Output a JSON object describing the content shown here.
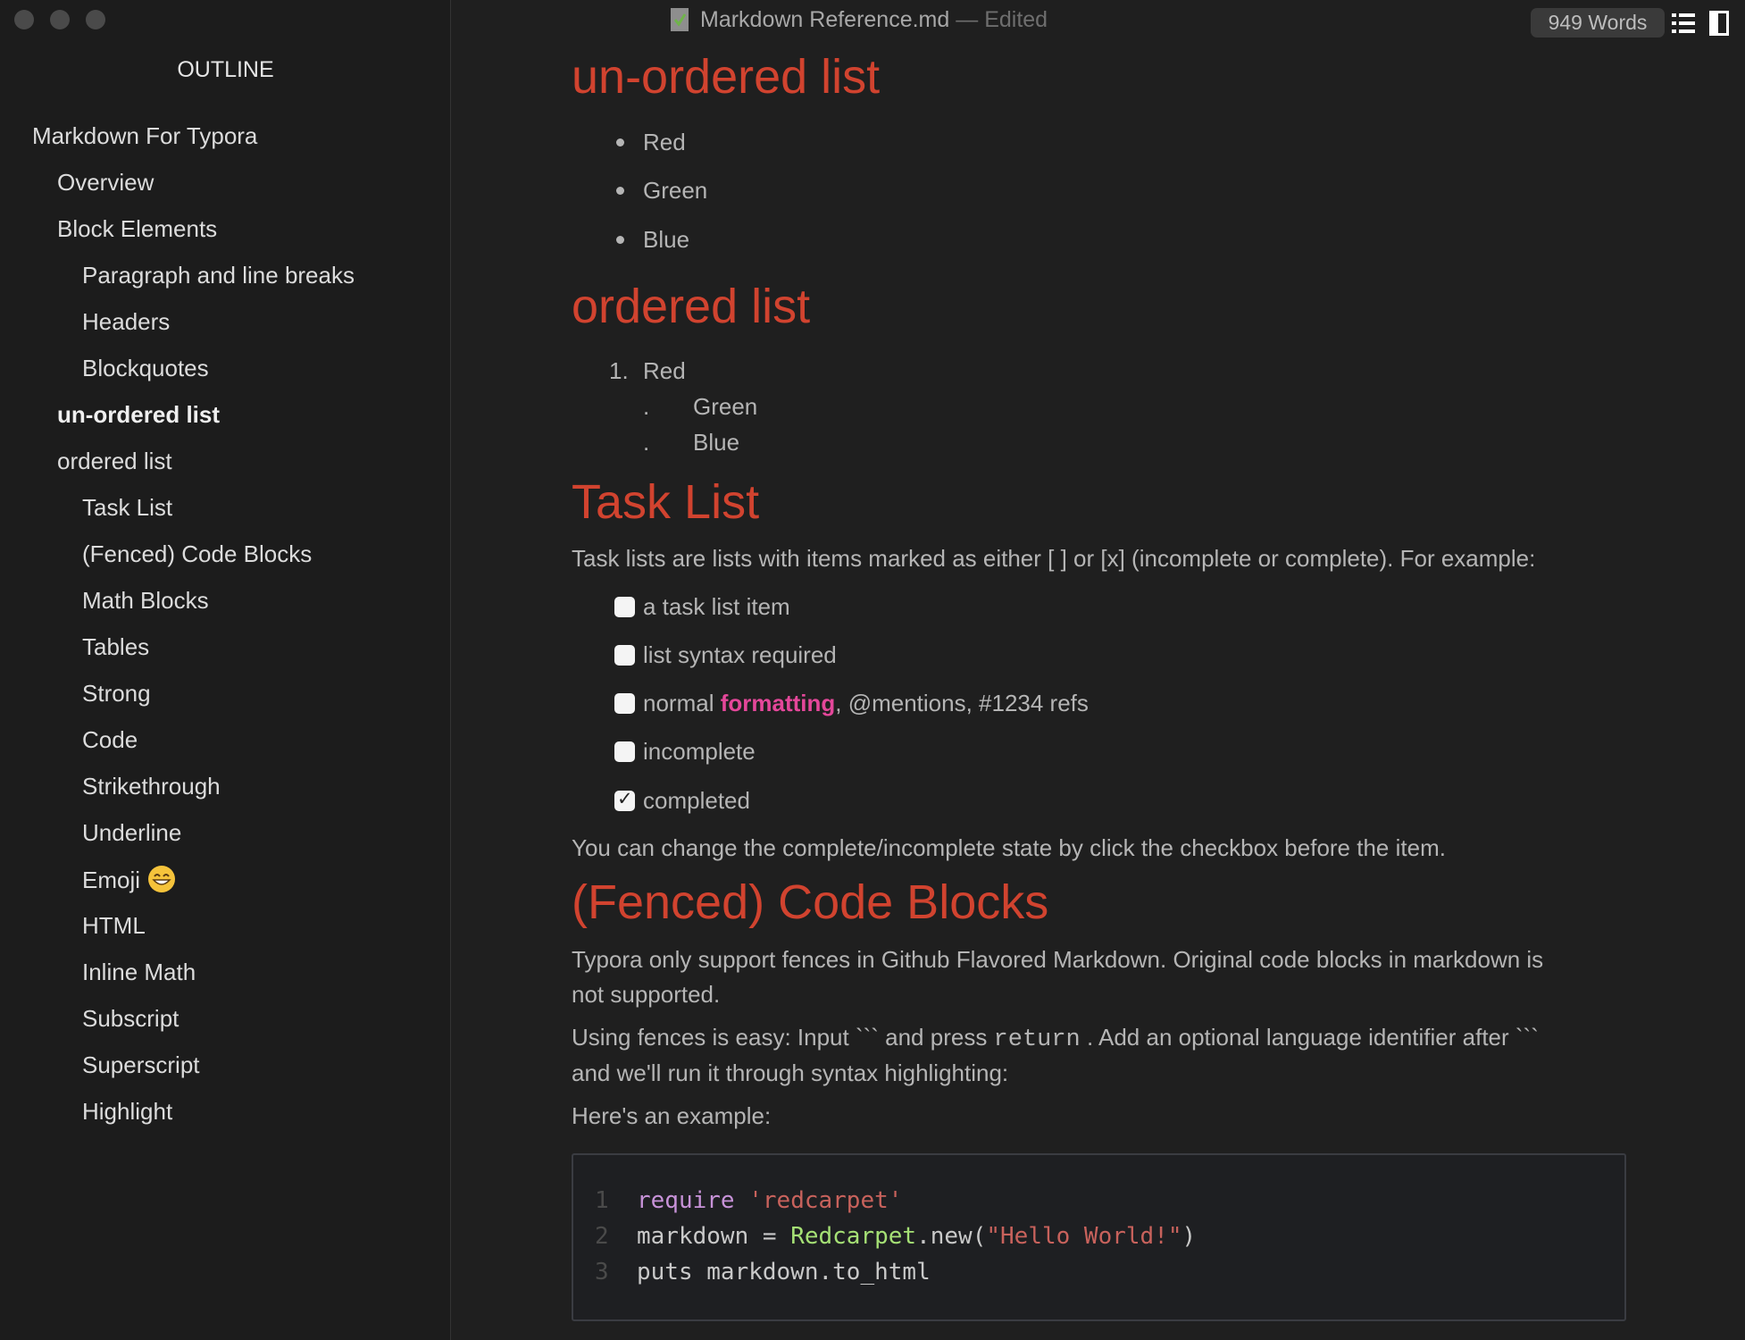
{
  "window": {
    "file_name": "Markdown Reference.md",
    "status": "— Edited",
    "word_count": "949 Words"
  },
  "sidebar": {
    "title": "OUTLINE",
    "items": [
      {
        "label": "Markdown For Typora",
        "level": 1
      },
      {
        "label": "Overview",
        "level": 2
      },
      {
        "label": "Block Elements",
        "level": 2
      },
      {
        "label": "Paragraph and line breaks",
        "level": 3
      },
      {
        "label": "Headers",
        "level": 3
      },
      {
        "label": "Blockquotes",
        "level": 3
      },
      {
        "label": "un-ordered list",
        "level": 2,
        "active": true
      },
      {
        "label": "ordered list",
        "level": 2
      },
      {
        "label": "Task List",
        "level": 3
      },
      {
        "label": "(Fenced) Code Blocks",
        "level": 3
      },
      {
        "label": "Math Blocks",
        "level": 3
      },
      {
        "label": "Tables",
        "level": 3
      },
      {
        "label": "Strong",
        "level": 3
      },
      {
        "label": "Code",
        "level": 3
      },
      {
        "label": "Strikethrough",
        "level": 3
      },
      {
        "label": "Underline",
        "level": 3
      },
      {
        "label": "Emoji",
        "level": 3,
        "emoji": "smile"
      },
      {
        "label": "HTML",
        "level": 3
      },
      {
        "label": "Inline Math",
        "level": 3
      },
      {
        "label": "Subscript",
        "level": 3
      },
      {
        "label": "Superscript",
        "level": 3
      },
      {
        "label": "Highlight",
        "level": 3
      }
    ]
  },
  "content": {
    "h_unordered": "un-ordered list",
    "unordered": [
      "Red",
      "Green",
      "Blue"
    ],
    "h_ordered": "ordered list",
    "ordered": {
      "first_marker": "1.",
      "first": "Red",
      "marker": ".",
      "rest": [
        "Green",
        "Blue"
      ]
    },
    "h_task": "Task List",
    "task_intro": "Task lists are lists with items marked as either [ ] or [x] (incomplete or complete). For example:",
    "tasks": [
      {
        "label": "a task list item",
        "checked": false
      },
      {
        "label": "list syntax required",
        "checked": false
      },
      {
        "pre": "normal ",
        "bold": "formatting",
        "post": ", @mentions, #1234 refs",
        "checked": false
      },
      {
        "label": "incomplete",
        "checked": false
      },
      {
        "label": "completed",
        "checked": true
      }
    ],
    "task_note": "You can change the complete/incomplete state by click the checkbox before the item.",
    "h_code": "(Fenced) Code Blocks",
    "code_p1a": "Typora only support fences in Github Flavored Markdown. Original code blocks in markdown is",
    "code_p1b": "not supported.",
    "code_p2a_pre": "Using fences is easy: Input ``` and press ",
    "code_p2a_code": "return",
    "code_p2a_post": " . Add an optional language identifier after ```",
    "code_p2b": "and we'll run it through syntax highlighting:",
    "code_p3": "Here's an example:",
    "code": {
      "line_numbers": [
        "1",
        "2",
        "3"
      ],
      "l1_kw": "require",
      "l1_str": "'redcarpet'",
      "l2_a": "markdown = ",
      "l2_cls": "Redcarpet",
      "l2_b": ".new(",
      "l2_str": "\"Hello World!\"",
      "l2_c": ")",
      "l3": "puts markdown.to_html"
    }
  },
  "colors": {
    "heading": "#d1432f",
    "highlight": "#e4479a",
    "background": "#1f1f1f"
  }
}
